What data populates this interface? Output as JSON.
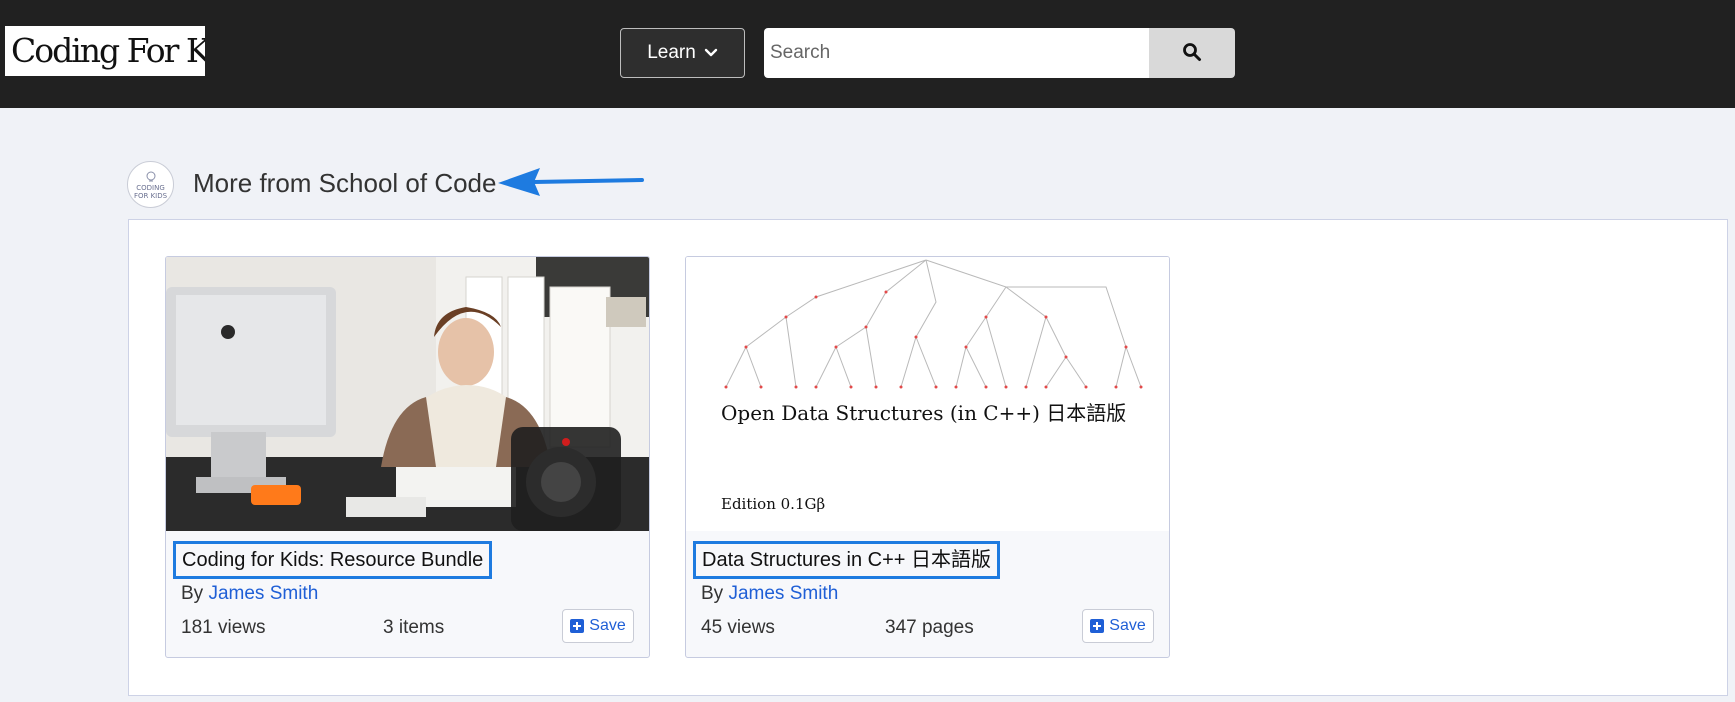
{
  "header": {
    "logo_text": "Coding For Kids",
    "learn_label": "Learn",
    "search_placeholder": "Search"
  },
  "section": {
    "avatar_line1": "CODING",
    "avatar_line2": "FOR KIDS",
    "title": "More from School of Code"
  },
  "cards": [
    {
      "title": "Coding for Kids: Resource Bundle",
      "by_label": "By",
      "author": "James Smith",
      "views": "181 views",
      "extra": "3 items",
      "save_label": "Save"
    },
    {
      "title": "Data Structures in C++ 日本語版",
      "by_label": "By",
      "author": "James Smith",
      "views": "45 views",
      "extra": "347 pages",
      "save_label": "Save",
      "cover_title": "Open Data Structures (in C++) 日本語版",
      "cover_edition": "Edition 0.1Gβ"
    }
  ],
  "colors": {
    "header_bg": "#212121",
    "page_bg": "#f0f2f7",
    "link": "#1f5fd6",
    "highlight": "#1e7be0"
  }
}
